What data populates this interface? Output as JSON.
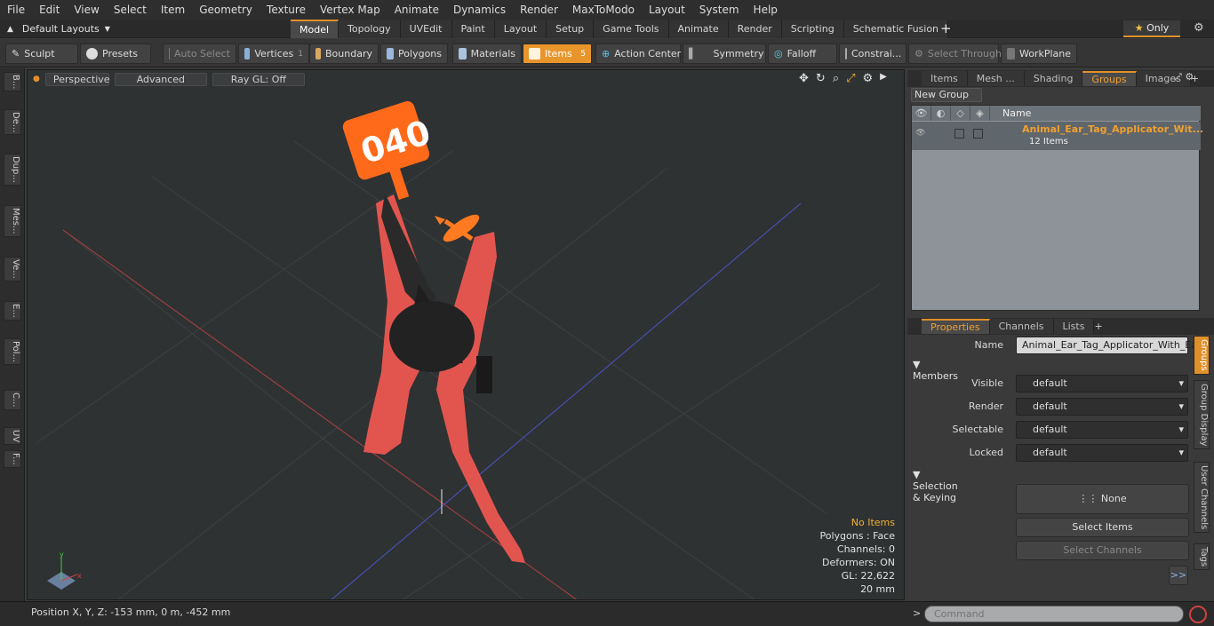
{
  "menu": [
    "File",
    "Edit",
    "View",
    "Select",
    "Item",
    "Geometry",
    "Texture",
    "Vertex Map",
    "Animate",
    "Dynamics",
    "Render",
    "MaxToModo",
    "Layout",
    "System",
    "Help"
  ],
  "layout_dropdown": "Default Layouts",
  "mode_tabs": [
    "Model",
    "Topology",
    "UVEdit",
    "Paint",
    "Layout",
    "Setup",
    "Game Tools",
    "Animate",
    "Render",
    "Scripting",
    "Schematic Fusion"
  ],
  "active_tab": "Model",
  "only_label": "Only",
  "toolbar": {
    "sculpt": "Sculpt",
    "presets": "Presets",
    "auto_select": "Auto Select",
    "vertices": "Vertices",
    "vertices_count": "1",
    "boundary": "Boundary",
    "polygons": "Polygons",
    "materials": "Materials",
    "items": "Items",
    "items_count": "5",
    "action_center": "Action Center",
    "symmetry": "Symmetry",
    "falloff": "Falloff",
    "constraints": "Constrai...",
    "select_through": "Select Through",
    "workplane": "WorkPlane"
  },
  "left_tabs": [
    "B...",
    "De...",
    "Dup...",
    "Mes...",
    "Ve...",
    "E...",
    "Pol...",
    "C...",
    "UV",
    "F..."
  ],
  "viewport": {
    "perspective": "Perspective",
    "advanced": "Advanced",
    "raygl": "Ray GL: Off",
    "tag_text": "040",
    "stats": {
      "items": "No Items",
      "polygons": "Polygons : Face",
      "channels": "Channels: 0",
      "deformers": "Deformers: ON",
      "gl": "GL: 22,622",
      "scale": "20 mm"
    }
  },
  "status": "Position X, Y, Z:  -153 mm, 0 m, -452 mm",
  "top_panel": {
    "tabs": [
      "Items",
      "Mesh ...",
      "Shading",
      "Groups",
      "Images"
    ],
    "active": "Groups",
    "new_group": "New Group",
    "name_col": "Name",
    "group_name": "Animal_Ear_Tag_Applicator_Wit...",
    "group_count": "12 Items"
  },
  "props_panel": {
    "tabs": [
      "Properties",
      "Channels",
      "Lists"
    ],
    "active": "Properties",
    "name_label": "Name",
    "name_value": "Animal_Ear_Tag_Applicator_With_Ear",
    "members": "Members",
    "visible_label": "Visible",
    "visible": "default",
    "render_label": "Render",
    "render": "default",
    "selectable_label": "Selectable",
    "selectable": "default",
    "locked_label": "Locked",
    "locked": "default",
    "selkey": "Selection & Keying",
    "none": "None",
    "select_items": "Select Items",
    "select_channels": "Select Channels",
    "more": ">>"
  },
  "right_vtabs": [
    "Groups",
    "Group Display",
    "User Channels",
    "Tags"
  ],
  "command_placeholder": "Command",
  "colors": {
    "accent": "#e8962c",
    "tool_red": "#e2554f",
    "tag_orange": "#ff6a1a"
  }
}
